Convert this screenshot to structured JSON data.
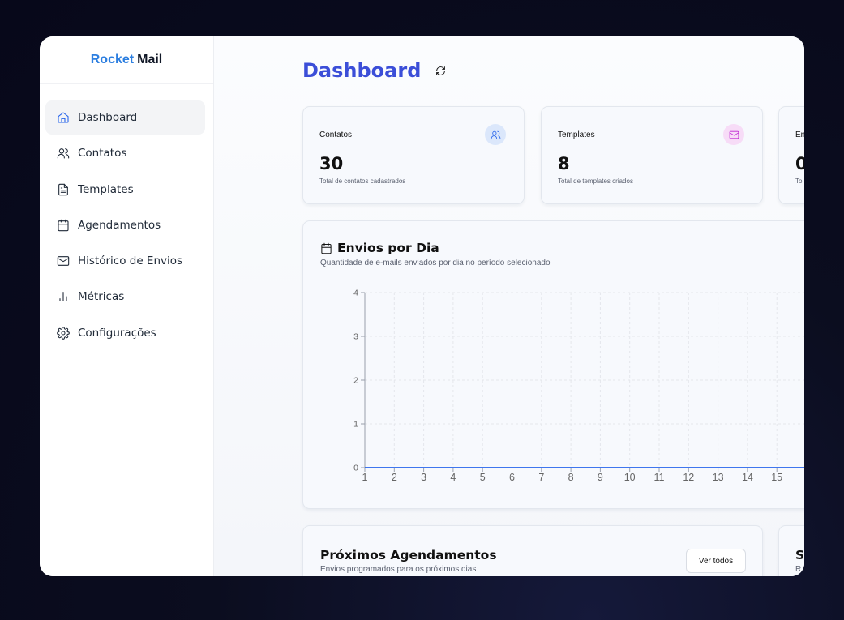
{
  "brand": {
    "part1": "Rocket",
    "part2": "Mail"
  },
  "sidebar": {
    "items": [
      {
        "label": "Dashboard",
        "icon": "home-icon",
        "active": true
      },
      {
        "label": "Contatos",
        "icon": "users-icon"
      },
      {
        "label": "Templates",
        "icon": "file-text-icon"
      },
      {
        "label": "Agendamentos",
        "icon": "calendar-icon"
      },
      {
        "label": "Histórico de Envios",
        "icon": "mail-icon"
      },
      {
        "label": "Métricas",
        "icon": "bar-chart-icon"
      },
      {
        "label": "Configurações",
        "icon": "gear-icon"
      }
    ]
  },
  "page": {
    "title": "Dashboard",
    "refresh_icon": "refresh-icon"
  },
  "stats": [
    {
      "label": "Contatos",
      "value": "30",
      "description": "Total de contatos cadastrados",
      "icon": "users-icon",
      "icon_bg": "#dbe7fb",
      "icon_color": "#2563eb"
    },
    {
      "label": "Templates",
      "value": "8",
      "description": "Total de templates criados",
      "icon": "mail-icon",
      "icon_bg": "#f7dcf7",
      "icon_color": "#c026d3"
    },
    {
      "label": "En",
      "value": "0",
      "description": "To"
    }
  ],
  "chart": {
    "title": "Envios por Dia",
    "subtitle": "Quantidade de e-mails enviados por dia no período selecionado",
    "icon": "calendar-icon"
  },
  "chart_data": {
    "type": "line",
    "title": "Envios por Dia",
    "x": [
      1,
      2,
      3,
      4,
      5,
      6,
      7,
      8,
      9,
      10,
      11,
      12,
      13,
      14,
      15
    ],
    "series": [
      {
        "values": [
          0,
          0,
          0,
          0,
          0,
          0,
          0,
          0,
          0,
          0,
          0,
          0,
          0,
          0,
          0
        ]
      }
    ],
    "yticks": [
      0,
      1,
      2,
      3,
      4
    ],
    "ylim": [
      0,
      4
    ],
    "grid": true,
    "line_color": "#2563eb"
  },
  "schedule": {
    "title": "Próximos Agendamentos",
    "subtitle": "Envios programados para os próximos dias",
    "button": "Ver todos"
  },
  "side_panel": {
    "title": "S",
    "subtitle": "R"
  }
}
